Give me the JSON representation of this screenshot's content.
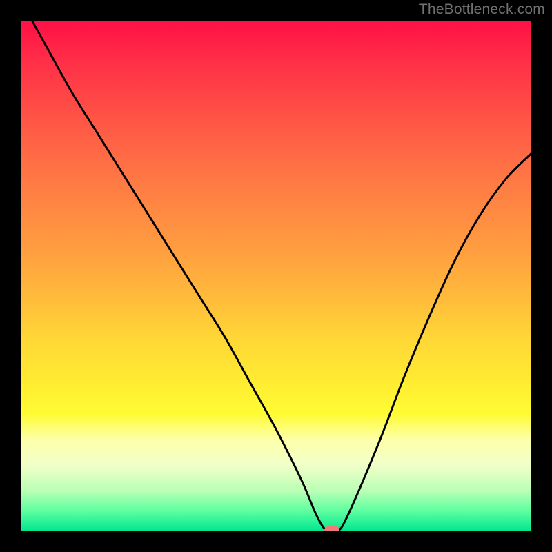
{
  "attribution": "TheBottleneck.com",
  "chart_data": {
    "type": "line",
    "title": "",
    "xlabel": "",
    "ylabel": "",
    "xlim": [
      0,
      100
    ],
    "ylim": [
      0,
      100
    ],
    "series": [
      {
        "name": "bottleneck-curve",
        "x": [
          0,
          5,
          10,
          15,
          20,
          25,
          30,
          35,
          40,
          45,
          50,
          55,
          58,
          60,
          62,
          64,
          70,
          75,
          80,
          85,
          90,
          95,
          100
        ],
        "y": [
          104,
          95,
          86,
          78,
          70,
          62,
          54,
          46,
          38,
          29,
          20,
          10,
          3,
          0,
          0,
          3,
          17,
          30,
          42,
          53,
          62,
          69,
          74
        ]
      }
    ],
    "marker": {
      "x": 61,
      "y": 0
    },
    "colors": {
      "gradient_top": "#ff1046",
      "gradient_mid": "#fffc33",
      "gradient_bottom": "#00e68e",
      "curve": "#000000",
      "marker": "#ee7b7a",
      "frame": "#000000"
    }
  }
}
